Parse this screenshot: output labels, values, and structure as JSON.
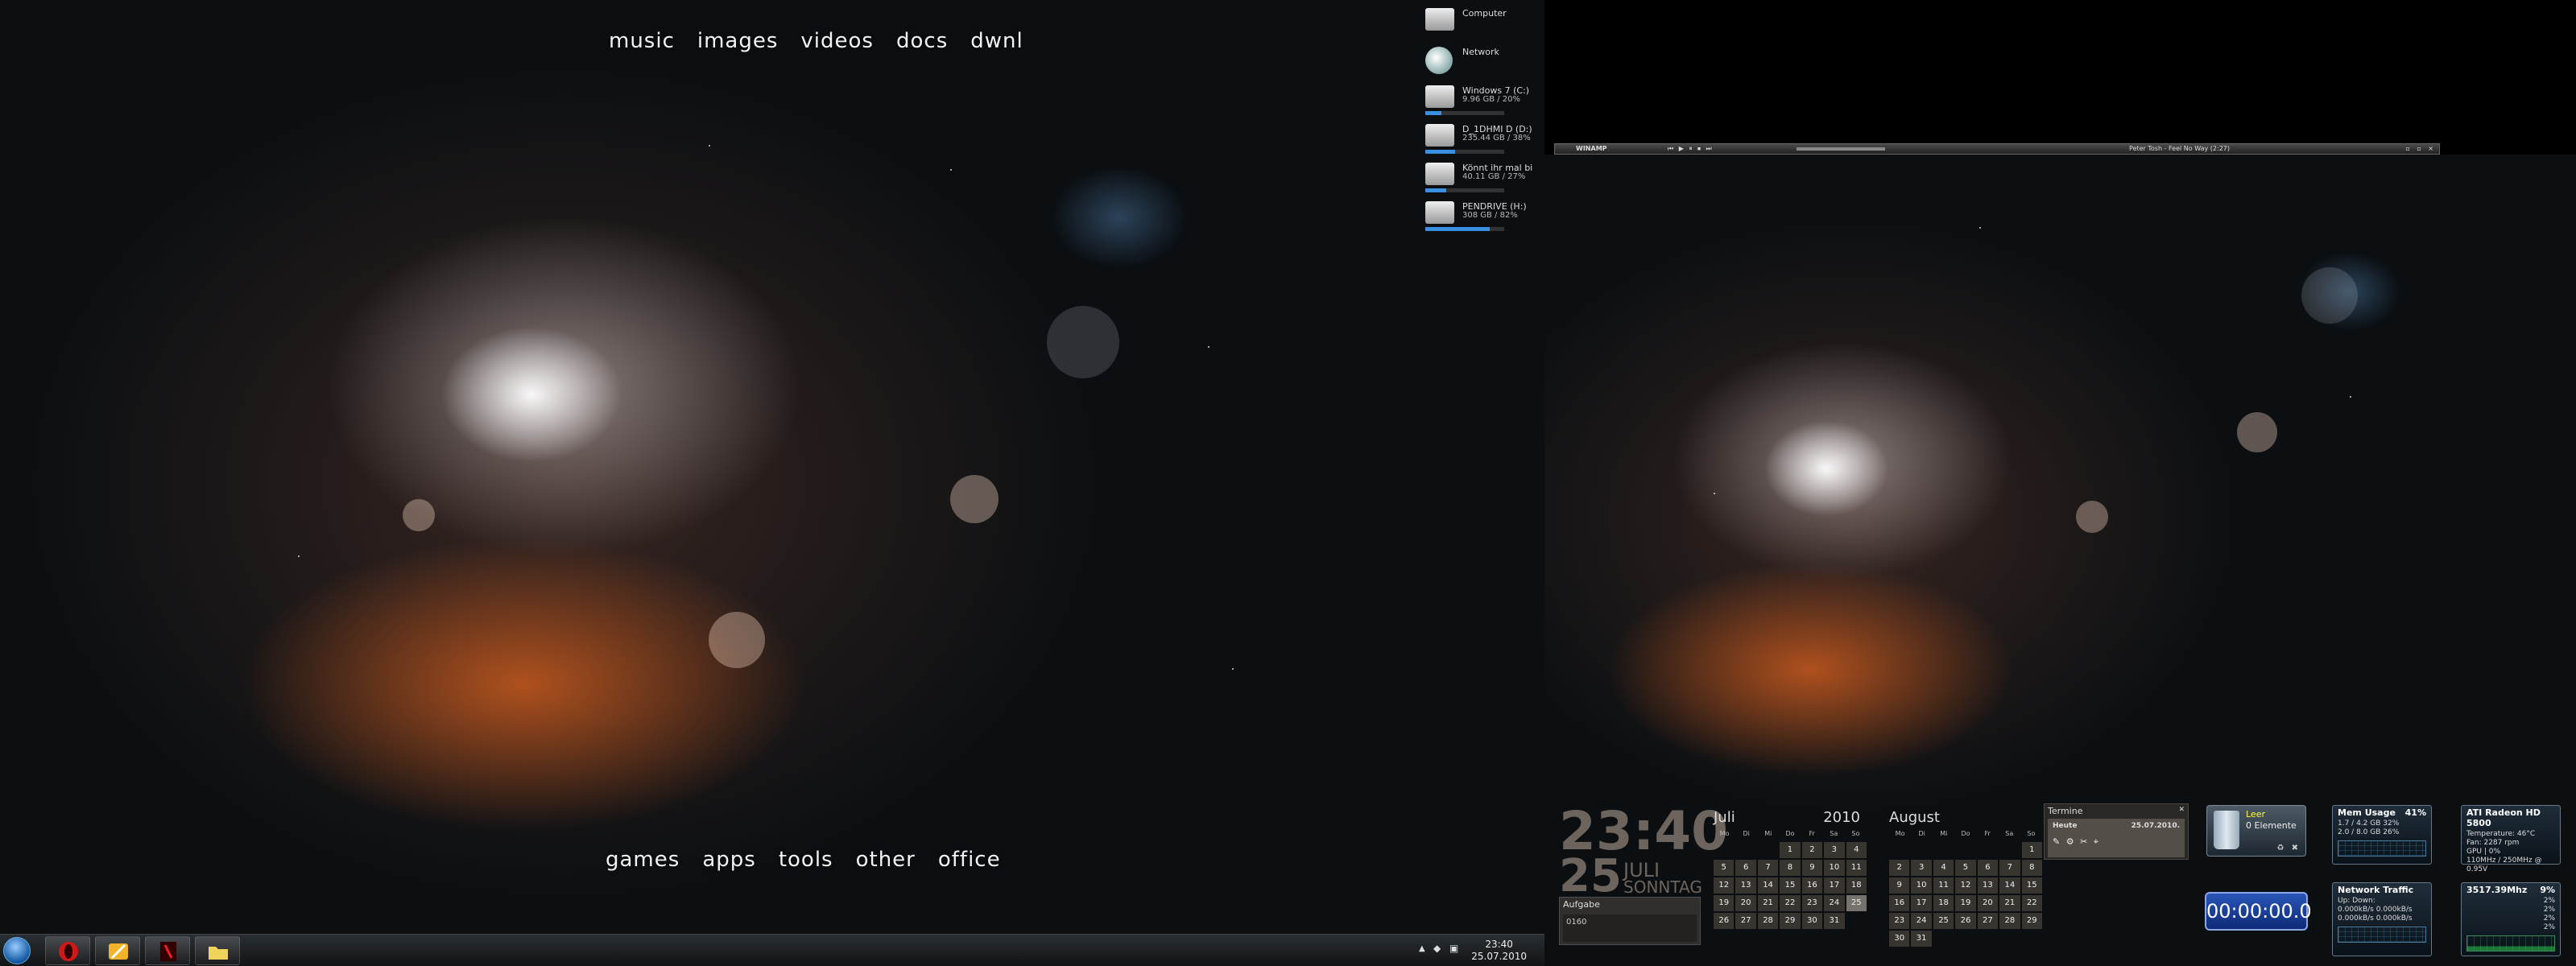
{
  "left_desktop": {
    "top_links": [
      "music",
      "images",
      "videos",
      "docs",
      "dwnl"
    ],
    "bottom_links": [
      "games",
      "apps",
      "tools",
      "other",
      "office"
    ]
  },
  "drives": [
    {
      "name": "Computer",
      "info": "",
      "fill": 0,
      "icon": "computer-icon"
    },
    {
      "name": "Network",
      "info": "",
      "fill": 0,
      "icon": "network-icon"
    },
    {
      "name": "Windows 7 (C:)",
      "info": "9.96 GB / 20%",
      "fill": 0.2,
      "icon": "drive-icon"
    },
    {
      "name": "D_1DHMI D (D:)",
      "info": "235.44 GB / 38%",
      "fill": 0.38,
      "icon": "drive-icon"
    },
    {
      "name": "Könnt ihr mal bi",
      "info": "40.11 GB / 27%",
      "fill": 0.27,
      "icon": "drive-icon"
    },
    {
      "name": "PENDRIVE (H:)",
      "info": "308 GB / 82%",
      "fill": 0.82,
      "icon": "usb-drive-icon"
    }
  ],
  "taskbar": {
    "time": "23:40",
    "date": "25.07.2010",
    "pinned": [
      "opera-icon",
      "media-player-icon",
      "app-icon",
      "folder-icon"
    ]
  },
  "winamp": {
    "title": "WINAMP",
    "song": "Peter Tosh - Feel No Way (2:27)"
  },
  "gadget_clock": {
    "time": "23:40",
    "day": "25",
    "month": "JULI",
    "weekday": "SONNTAG"
  },
  "todo": {
    "title": "Aufgabe",
    "value": "0160"
  },
  "calendars": [
    {
      "month": "Juli",
      "year": "2010",
      "weekdays": [
        "Mo",
        "Di",
        "Mi",
        "Do",
        "Fr",
        "Sa",
        "So"
      ],
      "offset": 3,
      "days": 31,
      "today": 25
    },
    {
      "month": "August",
      "year": "",
      "weekdays": [
        "Mo",
        "Di",
        "Mi",
        "Do",
        "Fr",
        "Sa",
        "So"
      ],
      "offset": 6,
      "days": 31,
      "today": 0
    }
  ],
  "termine": {
    "title": "Termine",
    "heute": "Heute",
    "date": "25.07.2010."
  },
  "recycle_bin": {
    "title": "Leer",
    "count": "0 Elemente"
  },
  "stopwatch": "00:00:00.0",
  "mem_meter": {
    "title": "Mem Usage",
    "value": "41%",
    "rows": [
      "1.7 / 4.2 GB  32%",
      "2.0 / 8.0 GB  26%"
    ]
  },
  "gpu_meter": {
    "title": "ATI Radeon HD 5800",
    "value": "",
    "rows": [
      "Temperature: 46°C",
      "Fan: 2287 rpm",
      "GPU | 0%",
      "110MHz / 250MHz @ 0.95V"
    ]
  },
  "net_meter": {
    "title": "Network Traffic",
    "value": "",
    "rows": [
      "Up:  Down:",
      "0.000kB/s  0.000kB/s",
      "0.000kB/s  0.000kB/s"
    ]
  },
  "cpu_meter": {
    "title": "3517.39Mhz",
    "value": "9%",
    "rows": [
      "2%",
      "2%",
      "2%",
      "2%"
    ]
  }
}
